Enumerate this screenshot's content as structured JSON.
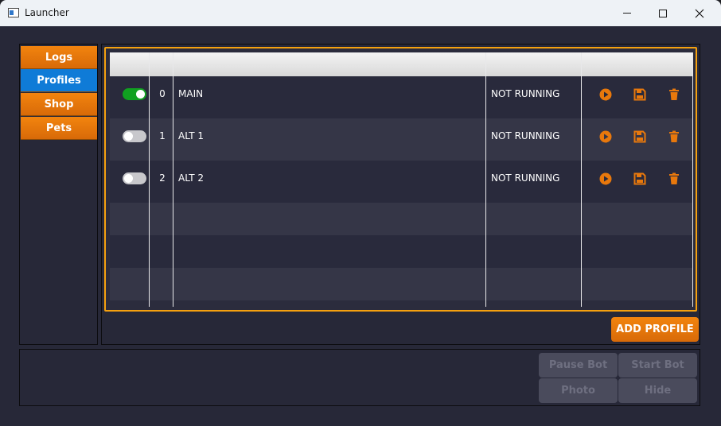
{
  "window": {
    "title": "Launcher",
    "minimize": "—",
    "maximize": "☐",
    "close": "✕"
  },
  "sidebar": {
    "items": [
      {
        "label": "Logs",
        "active": false
      },
      {
        "label": "Profiles",
        "active": true
      },
      {
        "label": "Shop",
        "active": false
      },
      {
        "label": "Pets",
        "active": false
      }
    ]
  },
  "profiles": {
    "columns": [
      "",
      "",
      "",
      "",
      ""
    ],
    "rows": [
      {
        "enabled": true,
        "index": "0",
        "name": "MAIN",
        "status": "NOT RUNNING"
      },
      {
        "enabled": false,
        "index": "1",
        "name": "ALT 1",
        "status": "NOT RUNNING"
      },
      {
        "enabled": false,
        "index": "2",
        "name": "ALT 2",
        "status": "NOT RUNNING"
      }
    ],
    "actions": {
      "play_icon": "play-icon",
      "save_icon": "save-icon",
      "delete_icon": "trash-icon"
    },
    "add_label": "ADD PROFILE"
  },
  "controls": {
    "pause_label": "Pause Bot",
    "start_label": "Start Bot",
    "photo_label": "Photo",
    "hide_label": "Hide"
  },
  "colors": {
    "accent": "#e8780c",
    "active_tab": "#0f7bd7",
    "toggle_on": "#10a020",
    "frame_highlight": "#f5a10f",
    "background": "#272838"
  }
}
